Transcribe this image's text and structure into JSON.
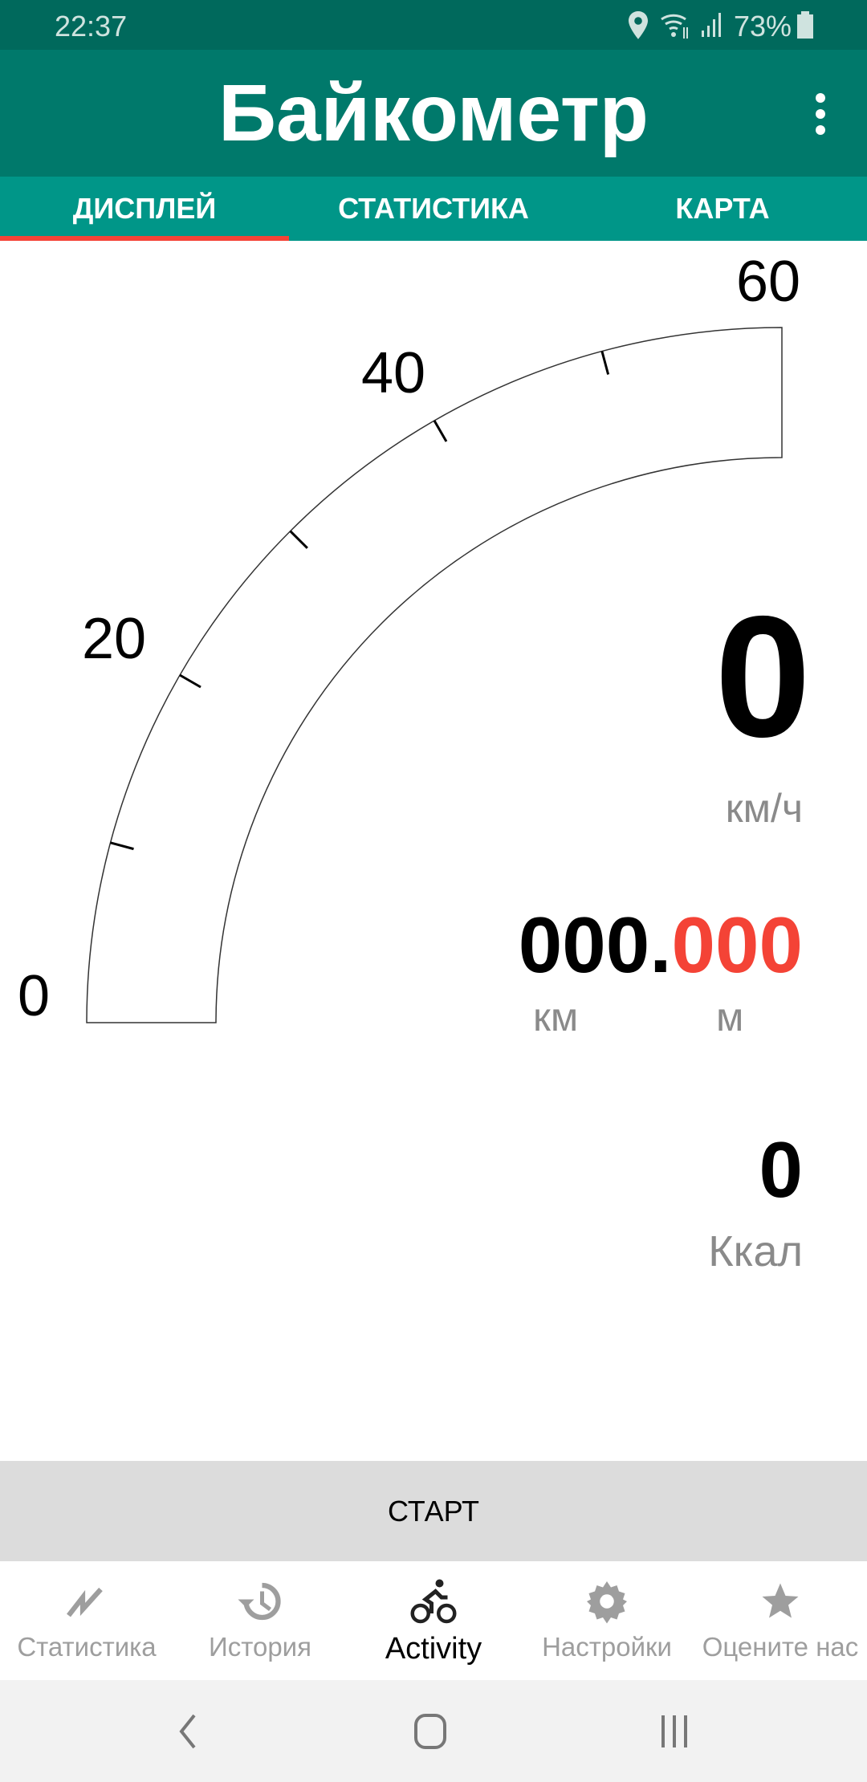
{
  "status_bar": {
    "time": "22:37",
    "battery": "73%",
    "icons": [
      "location-icon",
      "wifi-icon",
      "signal-icon",
      "battery-icon"
    ]
  },
  "app_bar": {
    "title": "Байкометр",
    "menu_icon": "more-vert-icon"
  },
  "tabs": [
    {
      "label": "ДИСПЛЕЙ",
      "active": true
    },
    {
      "label": "СТАТИСТИКА"
    },
    {
      "label": "КАРТА"
    }
  ],
  "gauge": {
    "labels": [
      "0",
      "20",
      "40",
      "60"
    ],
    "min": 0,
    "max": 60,
    "value": 0
  },
  "speed": {
    "value": "0",
    "unit": "км/ч"
  },
  "distance": {
    "km": "000.",
    "m": "000",
    "km_unit": "км",
    "m_unit": "м"
  },
  "calories": {
    "value": "0",
    "unit": "Ккал"
  },
  "start_button": "СТАРТ",
  "bottom_nav": [
    {
      "label": "Статистика",
      "icon": "trending-icon"
    },
    {
      "label": "История",
      "icon": "history-icon"
    },
    {
      "label": "Activity",
      "icon": "bike-icon",
      "active": true
    },
    {
      "label": "Настройки",
      "icon": "gear-icon"
    },
    {
      "label": "Оцените нас",
      "icon": "star-icon"
    }
  ],
  "colors": {
    "status": "#00695c",
    "primary": "#00796b",
    "tabs": "#009688",
    "indicator": "#f44336",
    "meters": "#f44336"
  }
}
